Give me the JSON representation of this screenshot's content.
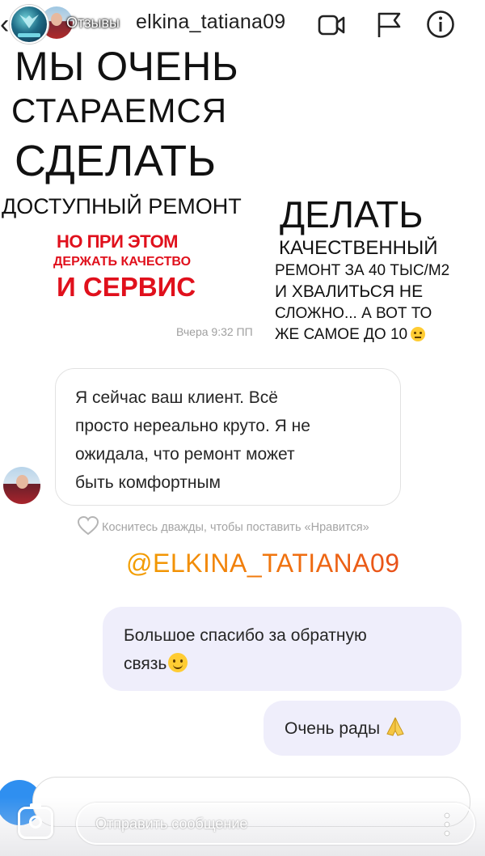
{
  "header": {
    "story_label": "Отзывы",
    "username": "elkina_tatiana09"
  },
  "story_text": {
    "left": [
      "МЫ ОЧЕНЬ",
      "СТАРАЕМСЯ",
      "СДЕЛАТЬ",
      "ДОСТУПНЫЙ РЕМОНТ"
    ],
    "left_red": [
      "НО ПРИ ЭТОМ",
      "ДЕРЖАТЬ КАЧЕСТВО",
      "И СЕРВИС"
    ],
    "right": [
      "ДЕЛАТЬ",
      "КАЧЕСТВЕННЫЙ",
      "РЕМОНТ ЗА 40 ТЫС/М2",
      "И ХВАЛИТЬСЯ НЕ",
      "СЛОЖНО... А ВОТ ТО",
      "ЖЕ САМОЕ ДО 10"
    ]
  },
  "chat": {
    "timestamp": "Вчера 9:32 ПП",
    "incoming": {
      "lines": [
        "Я сейчас ваш клиент. Всё",
        "просто нереально круто. Я не",
        "ожидала, что ремонт может",
        "быть комфортным"
      ]
    },
    "like_hint": "Коснитесь дважды, чтобы поставить «Нравится»",
    "mention": "@ELKINA_TATIANA09",
    "outgoing": [
      {
        "lines": [
          "Большое спасибо за обратную",
          "связь"
        ]
      },
      {
        "lines": [
          "Очень рады"
        ]
      }
    ]
  },
  "reply": {
    "placeholder": "Отправить сообщение"
  },
  "colors": {
    "accent_red": "#e0101c",
    "mention_gradient_start": "#f3a000",
    "mention_gradient_end": "#e8501a",
    "outgoing_bubble": "#efeefb"
  },
  "icons": [
    "chevron-left-icon",
    "video-call-icon",
    "flag-icon",
    "info-icon",
    "heart-icon",
    "camera-icon",
    "more-icon",
    "smile-emoji-icon",
    "pray-emoji-icon",
    "thinking-emoji-icon"
  ]
}
